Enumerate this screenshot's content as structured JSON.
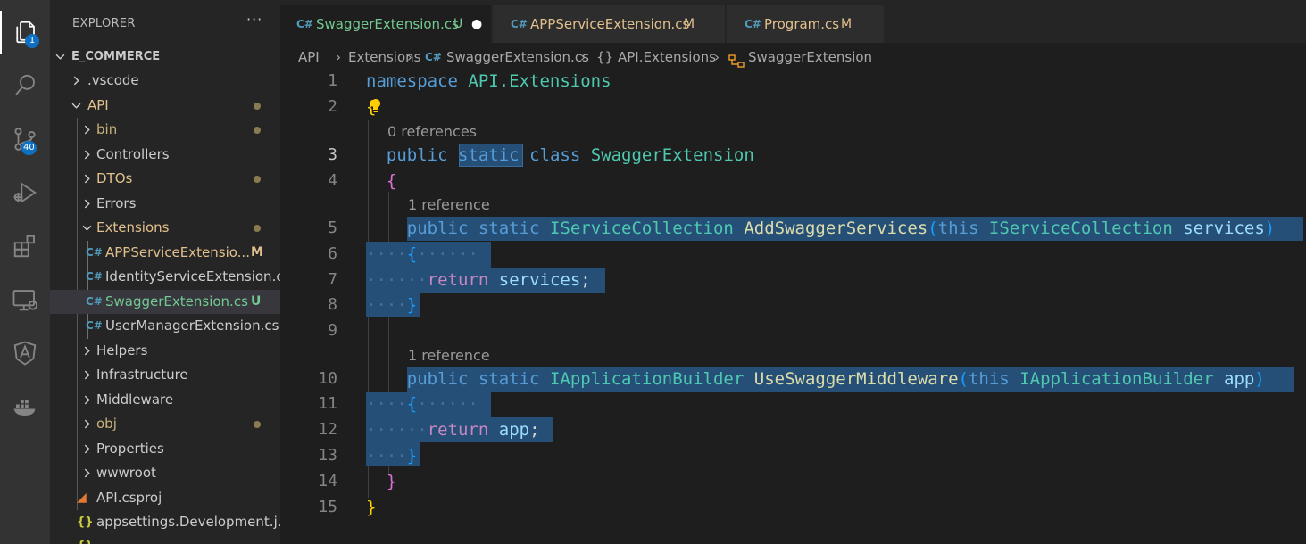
{
  "activity_bar": {
    "explorer_badge": "1",
    "scm_badge": "40",
    "items": [
      "explorer-icon",
      "search-icon",
      "source-control-icon",
      "run-debug-icon",
      "extensions-icon",
      "remote-explorer-icon",
      "angular-icon",
      "docker-icon"
    ]
  },
  "explorer": {
    "title": "EXPLORER",
    "more": "···",
    "root": "E_COMMERCE",
    "rows": [
      {
        "label": ".vscode"
      },
      {
        "label": "API"
      },
      {
        "label": "bin"
      },
      {
        "label": "Controllers"
      },
      {
        "label": "DTOs"
      },
      {
        "label": "Errors"
      },
      {
        "label": "Extensions"
      },
      {
        "label": "APPServiceExtensio...",
        "status": "M"
      },
      {
        "label": "IdentityServiceExtension.cs"
      },
      {
        "label": "SwaggerExtension.cs",
        "status": "U"
      },
      {
        "label": "UserManagerExtension.cs"
      },
      {
        "label": "Helpers"
      },
      {
        "label": "Infrastructure"
      },
      {
        "label": "Middleware"
      },
      {
        "label": "obj"
      },
      {
        "label": "Properties"
      },
      {
        "label": "wwwroot"
      },
      {
        "label": "API.csproj"
      },
      {
        "label": "appsettings.Development.j..."
      }
    ],
    "colors": {
      "modified": "#e2c08d",
      "untracked": "#73c991",
      "folder_dim": "#c9b27a"
    }
  },
  "tabs": [
    {
      "label": "SwaggerExtension.cs",
      "status": "U",
      "active": true,
      "dirty": "●"
    },
    {
      "label": "APPServiceExtension.cs",
      "status": "M"
    },
    {
      "label": "Program.cs",
      "status": "M"
    }
  ],
  "breadcrumb": {
    "items": [
      "API",
      "Extensions",
      "SwaggerExtension.cs",
      "API.Extensions",
      "SwaggerExtension"
    ],
    "sep": "›",
    "braces": "{}"
  },
  "editor": {
    "line_numbers": [
      "1",
      "2",
      "3",
      "4",
      "5",
      "6",
      "7",
      "8",
      "9",
      "10",
      "11",
      "12",
      "13",
      "14",
      "15"
    ],
    "current_line": "3",
    "codelens": [
      "0 references",
      "1 reference",
      "1 reference"
    ],
    "tokens": {
      "namespace": "namespace",
      "api_ext": "API.Extensions",
      "public": "public",
      "static": "static",
      "class": "class",
      "swagger_ext": "SwaggerExtension",
      "iservice": "IServiceCollection",
      "add_swagger": "AddSwaggerServices",
      "this": "this",
      "services": "services",
      "return": "return",
      "semicolon": ";",
      "iapp": "IApplicationBuilder",
      "use_swagger": "UseSwaggerMiddleware",
      "app": "app",
      "lbrace": "{",
      "rbrace": "}",
      "lparen": "(",
      "rparen": ")",
      "ws_dots_3": "···",
      "ws_dots_6": "······",
      "ws_dots_5": "·····",
      "ws_dot": "·"
    },
    "colors": {
      "selection": "#264f78",
      "keyword": "#569cd6",
      "type": "#4ec9b0",
      "function": "#dcdcaa",
      "variable": "#9cdcfe",
      "control": "#c586c0"
    }
  }
}
